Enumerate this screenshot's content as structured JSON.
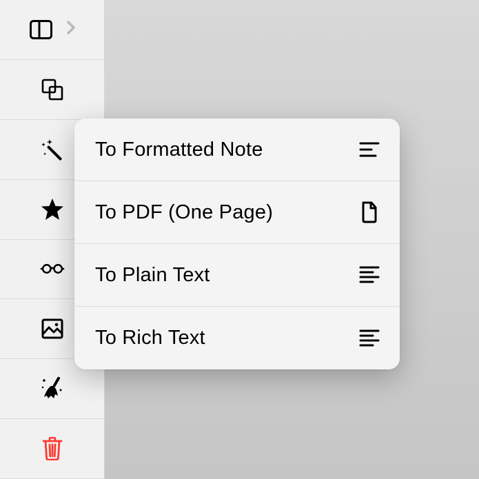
{
  "sidebar": {
    "items": [
      {
        "icon": "panel-icon"
      },
      {
        "icon": "merge-icon"
      },
      {
        "icon": "wand-icon"
      },
      {
        "icon": "star-icon"
      },
      {
        "icon": "glasses-icon"
      },
      {
        "icon": "image-icon"
      },
      {
        "icon": "broom-icon"
      },
      {
        "icon": "trash-icon"
      }
    ]
  },
  "menu": {
    "items": [
      {
        "label": "To Formatted Note",
        "icon": "text-lines-icon"
      },
      {
        "label": "To PDF (One Page)",
        "icon": "document-icon"
      },
      {
        "label": "To Plain Text",
        "icon": "text-left-icon"
      },
      {
        "label": "To Rich Text",
        "icon": "text-left-icon"
      }
    ]
  }
}
